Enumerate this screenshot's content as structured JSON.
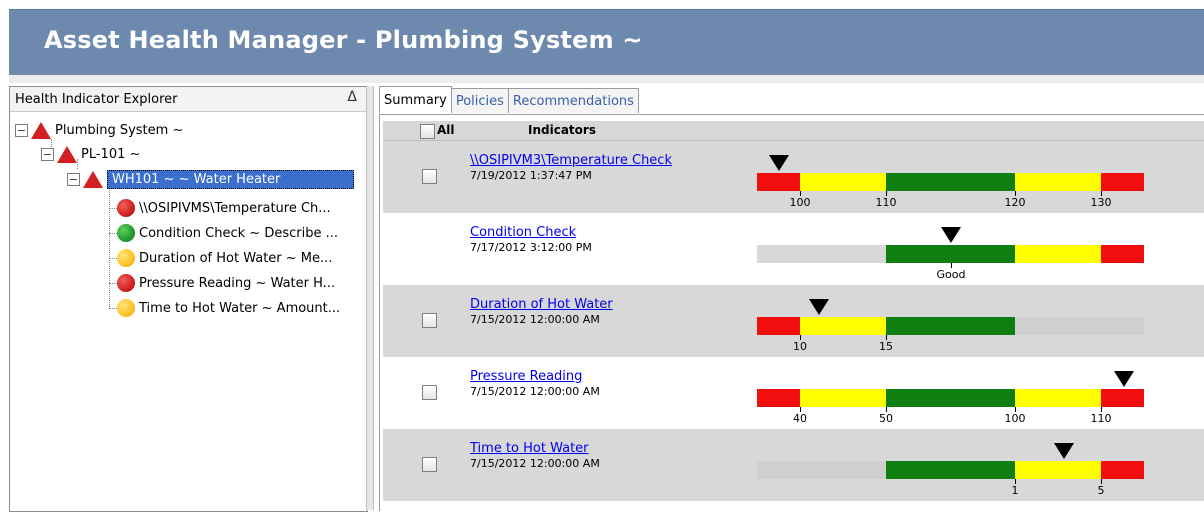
{
  "window": {
    "title": "Asset Health Manager - Plumbing System ~"
  },
  "explorer": {
    "header": "Health Indicator Explorer",
    "sort_icon": "Δ",
    "nodes": [
      {
        "label": "Plumbing System ~",
        "status": "red-triangle-icon"
      },
      {
        "label": "PL-101 ~",
        "status": "red-triangle-icon"
      },
      {
        "label": "WH101 ~  ~ Water Heater",
        "status": "red-triangle-icon",
        "selected": true
      },
      {
        "label": "\\\\OSIPIVMS\\Temperature Ch...",
        "status": "red-circle-icon"
      },
      {
        "label": "Condition Check ~ Describe ...",
        "status": "green-circle-icon"
      },
      {
        "label": "Duration of Hot Water ~ Me...",
        "status": "yellow-circle-icon"
      },
      {
        "label": "Pressure Reading ~ Water H...",
        "status": "red-circle-icon"
      },
      {
        "label": "Time to Hot Water ~ Amount...",
        "status": "yellow-circle-icon"
      }
    ]
  },
  "tabs": [
    {
      "label": "Summary",
      "active": true
    },
    {
      "label": "Policies",
      "active": false
    },
    {
      "label": "Recommendations",
      "active": false
    }
  ],
  "grid": {
    "all_label": "All",
    "indicators_label": "Indicators",
    "rows": [
      {
        "name": "\\\\OSIPIVM3\\Temperature Check",
        "date": "7/19/2012 1:37:47 PM",
        "has_checkbox": true,
        "segments": [
          "red",
          "yellow",
          "green",
          "yellow",
          "red"
        ],
        "ticks": [
          "100",
          "110",
          "120",
          "130"
        ],
        "marker": "on red segment, left"
      },
      {
        "name": "Condition Check",
        "date": "7/17/2012 3:12:00 PM",
        "has_checkbox": false,
        "segments": [
          "gray",
          "green",
          "yellow",
          "red"
        ],
        "ticks": [
          "Good"
        ],
        "marker": "on green segment at Good"
      },
      {
        "name": "Duration of Hot Water",
        "date": "7/15/2012 12:00:00 AM",
        "has_checkbox": true,
        "segments": [
          "red",
          "yellow",
          "green",
          "gray"
        ],
        "ticks": [
          "10",
          "15"
        ],
        "marker": "on yellow segment near 10"
      },
      {
        "name": "Pressure Reading",
        "date": "7/15/2012 12:00:00 AM",
        "has_checkbox": true,
        "segments": [
          "red",
          "yellow",
          "green",
          "yellow",
          "red"
        ],
        "ticks": [
          "40",
          "50",
          "100",
          "110"
        ],
        "marker": "on red segment, right"
      },
      {
        "name": "Time to Hot Water",
        "date": "7/15/2012 12:00:00 AM",
        "has_checkbox": true,
        "segments": [
          "gray",
          "green",
          "yellow",
          "red"
        ],
        "ticks": [
          "1",
          "5"
        ],
        "marker": "on yellow segment between 1 and 5"
      }
    ]
  },
  "colors": {
    "title_bar": "#6d89ad",
    "red": "#f20e0e",
    "yellow": "#ffff00",
    "green": "#0f7d0f",
    "gray": "#d8d8d8",
    "link": "#0000ee",
    "selection": "#3a6fce"
  }
}
